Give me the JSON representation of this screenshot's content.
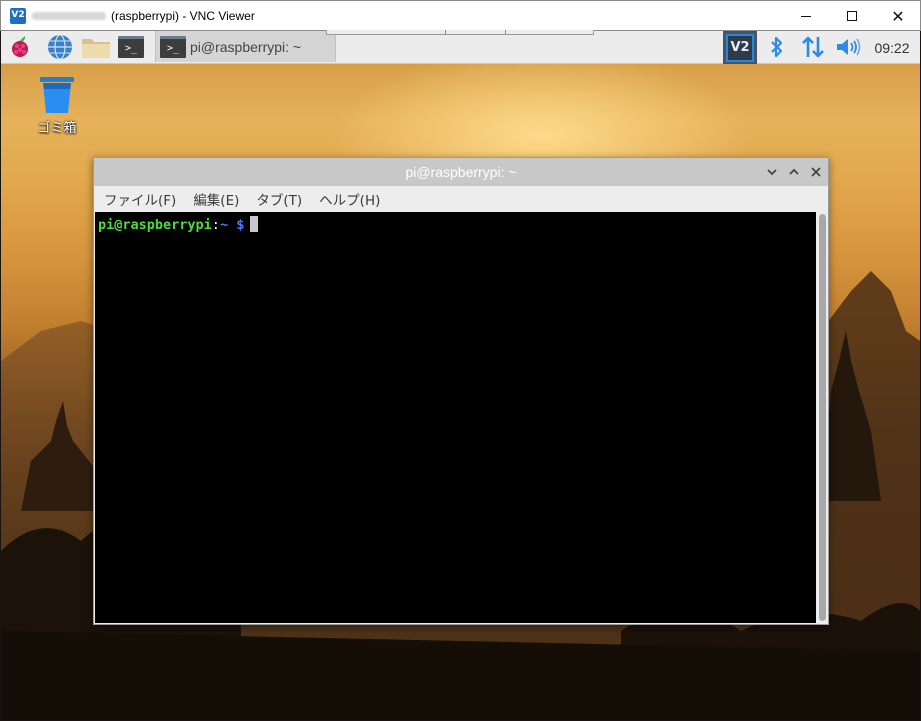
{
  "window": {
    "title": "(raspberrypi) - VNC Viewer",
    "app_icon_text": "V2",
    "controls": {
      "minimize": "minimize-icon",
      "maximize": "maximize-icon",
      "close": "close-icon"
    }
  },
  "panel": {
    "launchers": [
      {
        "name": "raspberry-menu",
        "icon": "raspberry-icon"
      },
      {
        "name": "web-browser",
        "icon": "globe-icon"
      },
      {
        "name": "file-manager",
        "icon": "folder-icon"
      },
      {
        "name": "terminal",
        "icon": "terminal-icon",
        "glyph": ">_"
      }
    ],
    "taskbar_item": {
      "label": "pi@raspberrypi: ~",
      "glyph": ">_"
    },
    "tray": {
      "vnc_label": "V2",
      "bluetooth_icon": "bluetooth-icon",
      "network_icon": "network-arrows-icon",
      "volume_icon": "volume-icon"
    },
    "clock": "09:22"
  },
  "desktop": {
    "trash": {
      "label": "ゴミ箱",
      "icon": "trash-bin-icon"
    }
  },
  "terminal": {
    "title": "pi@raspberrypi: ~",
    "menu": [
      "ファイル(F)",
      "編集(E)",
      "タブ(T)",
      "ヘルプ(H)"
    ],
    "prompt": {
      "user_host": "pi@raspberrypi",
      "sep": ":",
      "path": "~",
      "symbol": "$"
    }
  },
  "colors": {
    "prompt_user": "#4edc3b",
    "prompt_path": "#4a7bff",
    "vnc_blue": "#1e88e5",
    "tray_blue": "#2d8ae8"
  }
}
